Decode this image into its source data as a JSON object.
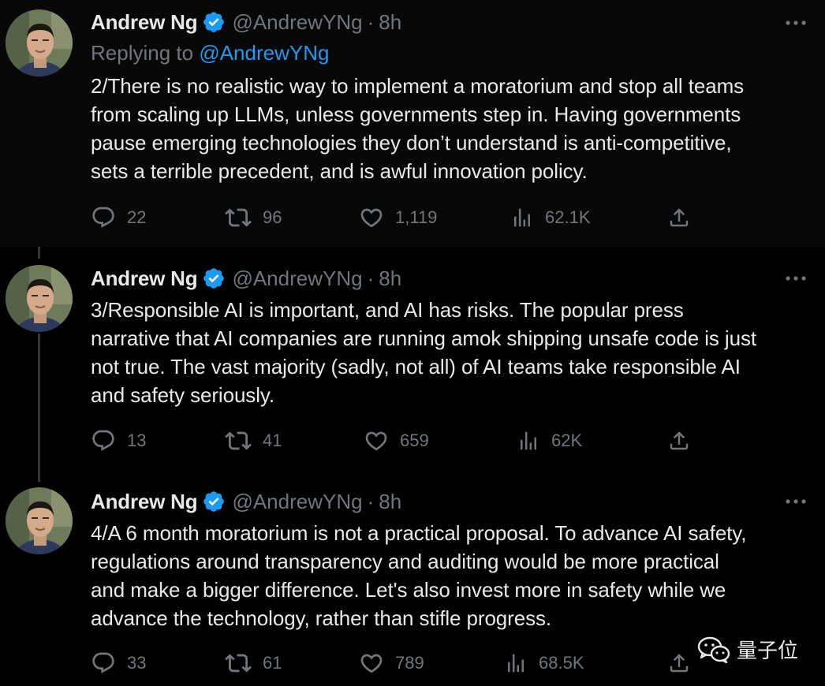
{
  "tweets": [
    {
      "author": "Andrew Ng",
      "handle": "@AndrewYNg",
      "separator": "·",
      "time": "8h",
      "replying_prefix": "Replying to",
      "replying_to": "@AndrewYNg",
      "lines": [
        "2/There is no realistic way to implement a moratorium and stop all teams",
        "from scaling up LLMs, unless governments step in. Having governments",
        "pause emerging technologies they don’t understand is anti-competitive,",
        "sets a terrible precedent, and is awful innovation policy."
      ],
      "replies": "22",
      "retweets": "96",
      "likes": "1,119",
      "views": "62.1K"
    },
    {
      "author": "Andrew Ng",
      "handle": "@AndrewYNg",
      "separator": "·",
      "time": "8h",
      "lines": [
        "3/Responsible AI is important, and AI has risks. The popular press",
        "narrative that AI companies are running amok shipping unsafe code is just",
        "not true. The vast majority (sadly, not all) of AI teams take responsible AI",
        "and safety seriously."
      ],
      "replies": "13",
      "retweets": "41",
      "likes": "659",
      "views": "62K"
    },
    {
      "author": "Andrew Ng",
      "handle": "@AndrewYNg",
      "separator": "·",
      "time": "8h",
      "lines": [
        "4/A 6 month moratorium is not a practical proposal. To advance AI safety,",
        "regulations around transparency and auditing would be more practical",
        "and make a bigger difference. Let's also invest more in safety while we",
        "advance the technology, rather than stifle progress."
      ],
      "replies": "33",
      "retweets": "61",
      "likes": "789",
      "views": "68.5K"
    }
  ],
  "watermark": {
    "text": "量子位",
    "icon": "wechat-icon"
  },
  "icons": {
    "verified": "verified-badge-icon",
    "more": "more-icon",
    "reply": "reply-icon",
    "retweet": "retweet-icon",
    "like": "heart-icon",
    "views": "views-icon",
    "share": "share-icon"
  },
  "colors": {
    "background": "#000000",
    "text": "#e7e9ea",
    "muted": "#71767b",
    "accent": "#1d9bf0",
    "thread_line": "#333639"
  }
}
